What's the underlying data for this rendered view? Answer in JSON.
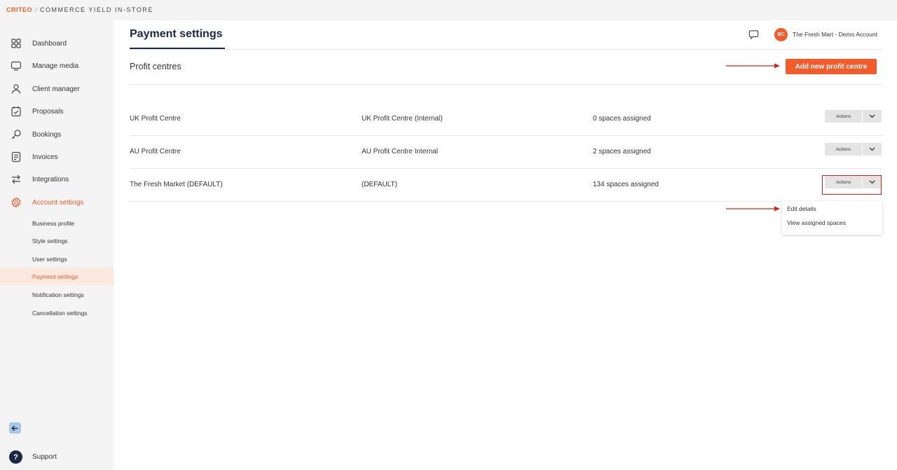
{
  "brand": {
    "logo": "CRITEO",
    "separator": "//",
    "product": "COMMERCE YIELD IN-STORE"
  },
  "sidebar": {
    "items": [
      {
        "label": "Dashboard",
        "icon": "grid-icon"
      },
      {
        "label": "Manage media",
        "icon": "monitor-icon"
      },
      {
        "label": "Client manager",
        "icon": "user-icon"
      },
      {
        "label": "Proposals",
        "icon": "proposal-icon"
      },
      {
        "label": "Bookings",
        "icon": "key-icon"
      },
      {
        "label": "Invoices",
        "icon": "invoice-icon"
      },
      {
        "label": "Integrations",
        "icon": "swap-arrows-icon"
      },
      {
        "label": "Account settings",
        "icon": "gear-icon",
        "active": true
      }
    ],
    "subitems": [
      {
        "label": "Business profile"
      },
      {
        "label": "Style settings"
      },
      {
        "label": "User settings"
      },
      {
        "label": "Payment settings",
        "active": true
      },
      {
        "label": "Notification settings"
      },
      {
        "label": "Cancellation settings"
      }
    ],
    "support_label": "Support"
  },
  "header": {
    "title": "Payment settings",
    "avatar_initials": "BC",
    "account_name": "The Fresh Mart - Demo Account"
  },
  "section": {
    "title": "Profit centres",
    "add_button_label": "Add new profit centre"
  },
  "rows": [
    {
      "name": "UK Profit Centre",
      "internal": "UK Profit Centre (Internal)",
      "spaces": "0 spaces assigned",
      "actions_label": "Actions"
    },
    {
      "name": "AU Profit Centre",
      "internal": "AU Profit Centre Internal",
      "spaces": "2 spaces assigned",
      "actions_label": "Actions"
    },
    {
      "name": "The Fresh Market (DEFAULT)",
      "internal": "(DEFAULT)",
      "spaces": "134 spaces assigned",
      "actions_label": "Actions"
    }
  ],
  "dropdown": {
    "options": [
      "Edit details",
      "View assigned spaces"
    ]
  },
  "colors": {
    "accent": "#f25c2a",
    "navy": "#1c2745",
    "annotation": "#e0201c",
    "active_bg": "#fde8df"
  }
}
